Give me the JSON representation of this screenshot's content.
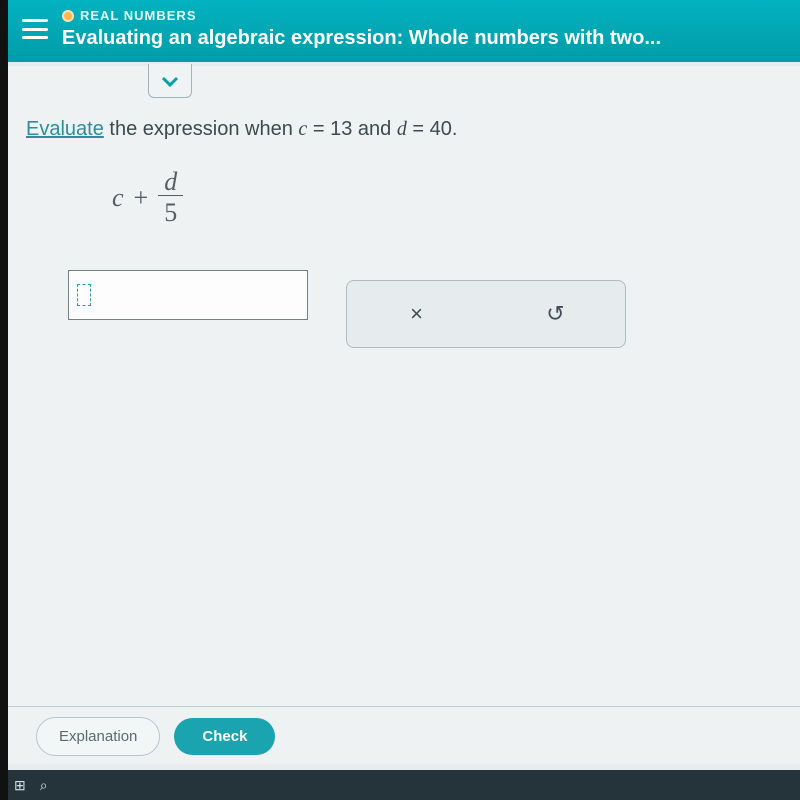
{
  "header": {
    "category": "REAL NUMBERS",
    "title": "Evaluating an algebraic expression: Whole numbers with two..."
  },
  "question": {
    "action_word": "Evaluate",
    "rest_1": " the expression when ",
    "var1": "c",
    "eq1": " = 13 and ",
    "var2": "d",
    "eq2": " = 40."
  },
  "expression": {
    "left": "c",
    "op": "+",
    "numerator": "d",
    "denominator": "5"
  },
  "tools": {
    "clear": "×",
    "undo": "↺"
  },
  "footer": {
    "explanation": "Explanation",
    "check": "Check"
  }
}
